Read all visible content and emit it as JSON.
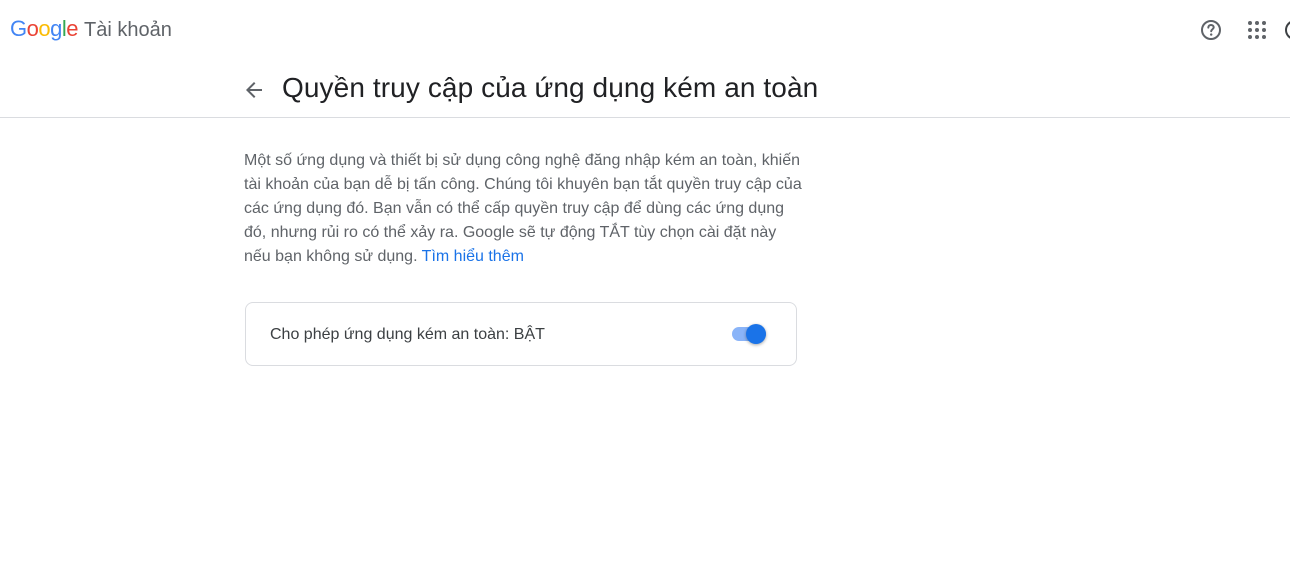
{
  "header": {
    "logo": {
      "letters": [
        {
          "ch": "G",
          "color": "#4285F4"
        },
        {
          "ch": "o",
          "color": "#EA4335"
        },
        {
          "ch": "o",
          "color": "#FBBC05"
        },
        {
          "ch": "g",
          "color": "#4285F4"
        },
        {
          "ch": "l",
          "color": "#34A853"
        },
        {
          "ch": "e",
          "color": "#EA4335"
        }
      ]
    },
    "product_name": "Tài khoản",
    "icons": {
      "help": "help-circle-icon",
      "apps": "apps-grid-icon"
    }
  },
  "page": {
    "back_icon": "arrow-back-icon",
    "title": "Quyền truy cập của ứng dụng kém an toàn",
    "description": "Một số ứng dụng và thiết bị sử dụng công nghệ đăng nhập kém an toàn, khiến tài khoản của bạn dễ bị tấn công. Chúng tôi khuyên bạn tắt quyền truy cập của các ứng dụng đó. Bạn vẫn có thể cấp quyền truy cập để dùng các ứng dụng đó, nhưng rủi ro có thể xảy ra. Google sẽ tự động TẮT tùy chọn cài đặt này nếu bạn không sử dụng.",
    "learn_more": "Tìm hiểu thêm"
  },
  "setting": {
    "label": "Cho phép ứng dụng kém an toàn: BẬT",
    "enabled": true
  },
  "colors": {
    "accent": "#1a73e8",
    "track_on": "#8ab4f8",
    "text_primary": "#202124",
    "text_secondary": "#5f6368",
    "divider": "#dadce0"
  }
}
